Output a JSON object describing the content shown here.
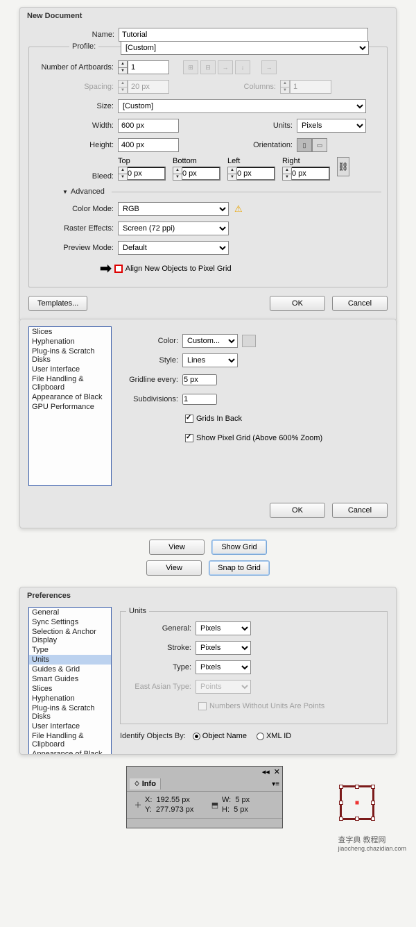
{
  "newDoc": {
    "title": "New Document",
    "name_lbl": "Name:",
    "name": "Tutorial",
    "profile_lbl": "Profile:",
    "profile": "[Custom]",
    "artboards_lbl": "Number of Artboards:",
    "artboards": "1",
    "spacing_lbl": "Spacing:",
    "spacing": "20 px",
    "columns_lbl": "Columns:",
    "columns": "1",
    "size_lbl": "Size:",
    "size": "[Custom]",
    "width_lbl": "Width:",
    "width": "600 px",
    "units_lbl": "Units:",
    "units": "Pixels",
    "height_lbl": "Height:",
    "height": "400 px",
    "orient_lbl": "Orientation:",
    "bleed_lbl": "Bleed:",
    "bleed_top_lbl": "Top",
    "bleed_bottom_lbl": "Bottom",
    "bleed_left_lbl": "Left",
    "bleed_right_lbl": "Right",
    "bleed_val": "0 px",
    "advanced": "Advanced",
    "colormode_lbl": "Color Mode:",
    "colormode": "RGB",
    "raster_lbl": "Raster Effects:",
    "raster": "Screen (72 ppi)",
    "preview_lbl": "Preview Mode:",
    "preview": "Default",
    "align_lbl": "Align New Objects to Pixel Grid",
    "templates": "Templates...",
    "ok": "OK",
    "cancel": "Cancel"
  },
  "prefGrid": {
    "list": [
      "Slices",
      "Hyphenation",
      "Plug-ins & Scratch Disks",
      "User Interface",
      "File Handling & Clipboard",
      "Appearance of Black",
      "GPU Performance"
    ],
    "color_lbl": "Color:",
    "color": "Custom...",
    "style_lbl": "Style:",
    "style": "Lines",
    "gridline_lbl": "Gridline every:",
    "gridline": "5 px",
    "subdiv_lbl": "Subdivisions:",
    "subdiv": "1",
    "cb1": "Grids In Back",
    "cb2": "Show Pixel Grid (Above 600% Zoom)",
    "ok": "OK",
    "cancel": "Cancel"
  },
  "mid": {
    "view": "View",
    "showgrid": "Show Grid",
    "snap": "Snap to Grid"
  },
  "prefUnits": {
    "title": "Preferences",
    "list": [
      "General",
      "Sync Settings",
      "Selection & Anchor Display",
      "Type",
      "Units",
      "Guides & Grid",
      "Smart Guides",
      "Slices",
      "Hyphenation",
      "Plug-ins & Scratch Disks",
      "User Interface",
      "File Handling & Clipboard",
      "Appearance of Black"
    ],
    "selected": "Units",
    "section": "Units",
    "general_lbl": "General:",
    "general": "Pixels",
    "stroke_lbl": "Stroke:",
    "stroke": "Pixels",
    "type_lbl": "Type:",
    "type": "Pixels",
    "eat_lbl": "East Asian Type:",
    "eat": "Points",
    "nopts": "Numbers Without Units Are Points",
    "identify_lbl": "Identify Objects By:",
    "obj_name": "Object Name",
    "xml_id": "XML ID"
  },
  "info": {
    "title": "Info",
    "x_lbl": "X:",
    "x": "192.55 px",
    "y_lbl": "Y:",
    "y": "277.973 px",
    "w_lbl": "W:",
    "w": "5 px",
    "h_lbl": "H:",
    "h": "5 px"
  },
  "watermark": "查字典  教程网",
  "watermark2": "jiaocheng.chazidian.com"
}
